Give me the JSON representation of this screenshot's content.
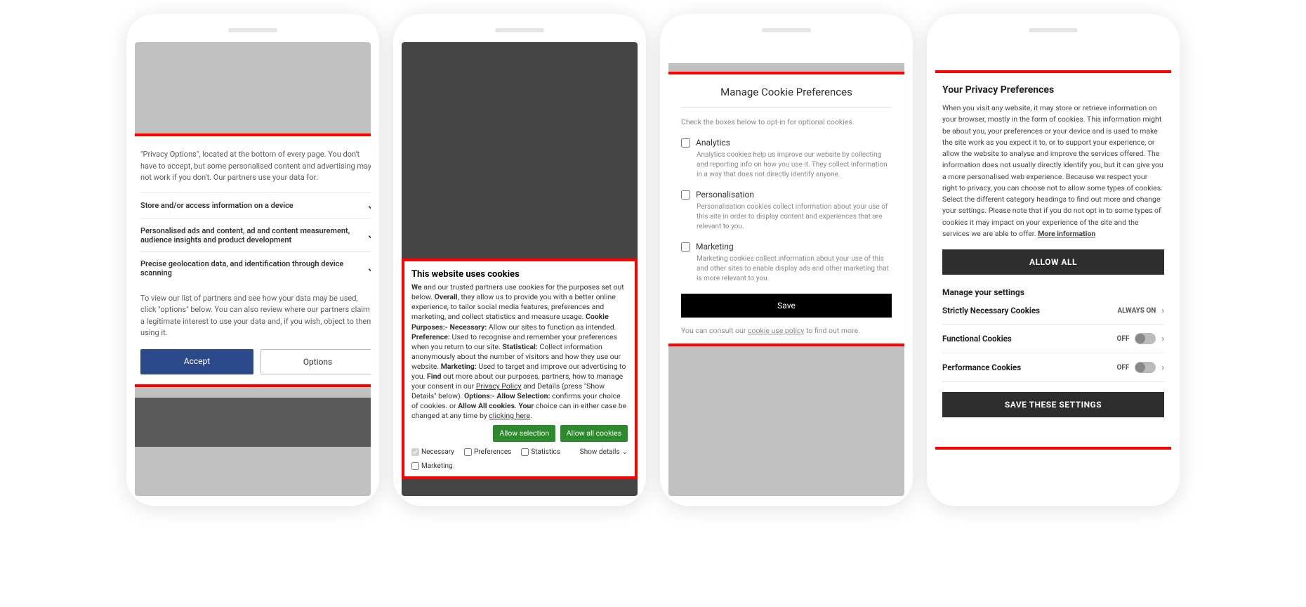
{
  "phone1": {
    "intro": "\"Privacy Options\", located at the bottom of every page. You don't have to accept, but some personalised content and advertising may not work if you don't. Our partners use your data for:",
    "acc1": "Store and/or access information on a device",
    "acc2": "Personalised ads and content, ad and content measurement, audience insights and product development",
    "acc3": "Precise geolocation data, and identification through device scanning",
    "note": "To view our list of partners and see how your data may be used, click \"options\" below. You can also review where our partners claim a legitimate interest to use your data and, if you wish, object to them using it.",
    "accept": "Accept",
    "options": "Options"
  },
  "phone2": {
    "title": "This website uses cookies",
    "we": "We",
    "t1": " and our trusted partners use cookies for the purposes set out below. ",
    "overall": "Overall",
    "t2": ", they allow us to provide you with a better online experience, to tailor social media features, preferences and marketing, and collect statistics and measure usage. ",
    "cp": "Cookie Purposes:- Necessary:",
    "t3": " Allow our sites to function as intended. ",
    "pref": "Preference:",
    "t4": " Used to recognise and remember your preferences when you return to our site. ",
    "stat": "Statistical:",
    "t5": " Collect information anonymously about the number of visitors and how they use our website. ",
    "mkt": "Marketing:",
    "t6": " Used to target and improve our advertising to you. ",
    "find": "Find",
    "t7": " out more about our purposes, partners, how to manage your consent in our ",
    "pp": "Privacy Policy",
    "t8": " and Details (press \"Show Details\" below). ",
    "opt": "Options:- Allow Selection:",
    "t9": " confirms your choice of cookies. or ",
    "aac": "Allow All cookies",
    "t10": ". ",
    "your": "Your",
    "t11": " choice can in either case be changed at any time by ",
    "ch": "clicking here",
    "t12": ".",
    "btn_sel": "Allow selection",
    "btn_all": "Allow all cookies",
    "chk_nec": "Necessary",
    "chk_pref": "Preferences",
    "chk_stat": "Statistics",
    "chk_mkt": "Marketing",
    "show_details": "Show details"
  },
  "phone3": {
    "title": "Manage Cookie Preferences",
    "sub": "Check the boxes below to opt-in for optional cookies.",
    "a_title": "Analytics",
    "a_desc": "Analytics cookies help us improve our website by collecting and reporting info on how you use it. They collect information in a way that does not directly identify anyone.",
    "p_title": "Personalisation",
    "p_desc": "Personalisation cookies collect information about your use of this site in order to display content and experiences that are relevant to you.",
    "m_title": "Marketing",
    "m_desc": "Marketing cookies collect information about your use of this and other sites to enable display ads and other marketing that is more relevant to you.",
    "save": "Save",
    "consult1": "You can consult our ",
    "consult_link": "cookie use policy",
    "consult2": " to find out more."
  },
  "phone4": {
    "title": "Your Privacy Preferences",
    "body1": "When you visit any website, it may store or retrieve information on your browser, mostly in the form of cookies. This information might be about you, your preferences or your device and is used to make the site work as you expect it to, or to support your experience, or allow the website to analyse and improve the services offered. The information does not usually directly identify you, but it can give you a more personalised web experience. Because we respect your right to privacy, you can choose not to allow some types of cookies. Select the different category headings to find out more and change your settings. Please note that if you do not opt in to some types of cookies it may impact on your experience of the site and the services we are able to offer.  ",
    "more": "More information",
    "allow_all": "ALLOW ALL",
    "manage": "Manage your settings",
    "s1": "Strictly Necessary Cookies",
    "s1_state": "ALWAYS ON",
    "s2": "Functional Cookies",
    "s2_state": "OFF",
    "s3": "Performance Cookies",
    "s3_state": "OFF",
    "save": "SAVE THESE SETTINGS"
  }
}
